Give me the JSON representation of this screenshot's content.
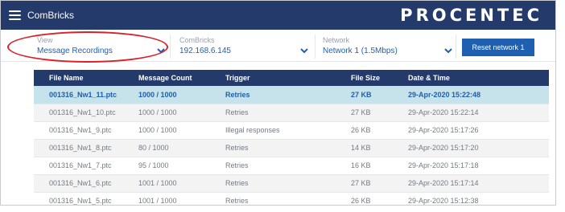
{
  "header": {
    "app_title": "ComBricks",
    "brand": "PROCENTEC"
  },
  "filters": {
    "view": {
      "label": "View",
      "value": "Message Recordings"
    },
    "combricks": {
      "label": "ComBricks",
      "value": "192.168.6.145"
    },
    "network": {
      "label": "Network",
      "value": "Network 1 (1.5Mbps)"
    },
    "reset_label": "Reset network 1"
  },
  "table": {
    "columns": [
      "File Name",
      "Message Count",
      "Trigger",
      "File Size",
      "Date & Time"
    ],
    "rows": [
      {
        "file": "001316_Nw1_11.ptc",
        "count": "1000 / 1000",
        "trigger": "Retries",
        "size": "27 KB",
        "date": "29-Apr-2020 15:22:48",
        "selected": true
      },
      {
        "file": "001316_Nw1_10.ptc",
        "count": "1000 / 1000",
        "trigger": "Retries",
        "size": "27 KB",
        "date": "29-Apr-2020 15:22:14"
      },
      {
        "file": "001316_Nw1_9.ptc",
        "count": "1000 / 1000",
        "trigger": "Illegal responses",
        "size": "26 KB",
        "date": "29-Apr-2020 15:17:26"
      },
      {
        "file": "001316_Nw1_8.ptc",
        "count": "80 / 1000",
        "trigger": "Retries",
        "size": "14 KB",
        "date": "29-Apr-2020 15:17:20"
      },
      {
        "file": "001316_Nw1_7.ptc",
        "count": "95 / 1000",
        "trigger": "Retries",
        "size": "16 KB",
        "date": "29-Apr-2020 15:17:18"
      },
      {
        "file": "001316_Nw1_6.ptc",
        "count": "1001 / 1000",
        "trigger": "Retries",
        "size": "27 KB",
        "date": "29-Apr-2020 15:17:14"
      },
      {
        "file": "001316_Nw1_5.ptc",
        "count": "1001 / 1000",
        "trigger": "Retries",
        "size": "26 KB",
        "date": "29-Apr-2020 15:12:38"
      }
    ]
  },
  "icons": {
    "menu": "hamburger-menu-icon",
    "dropdown": "chevron-down-icon"
  },
  "colors": {
    "header_bg": "#233a6a",
    "accent": "#1f5fb0",
    "selected_row": "#c6e2ea",
    "annotation": "#d8232a"
  }
}
